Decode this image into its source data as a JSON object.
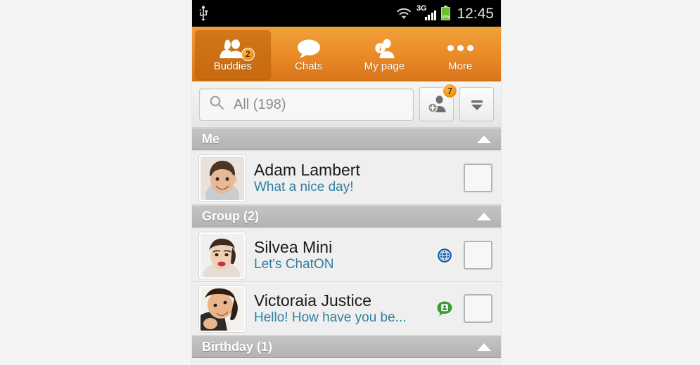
{
  "statusbar": {
    "usb_icon": "usb-icon",
    "wifi_icon": "wifi-icon",
    "network": "3G",
    "signal_icon": "signal-bars-icon",
    "battery_icon": "battery-icon",
    "battery_percent": "97%",
    "clock": "12:45"
  },
  "tabs": [
    {
      "label": "Buddies",
      "icon": "buddies-icon",
      "badge": "2",
      "active": true
    },
    {
      "label": "Chats",
      "icon": "chat-bubble-icon",
      "badge": "",
      "active": false
    },
    {
      "label": "My page",
      "icon": "my-page-info-icon",
      "badge": "",
      "active": false
    },
    {
      "label": "More",
      "icon": "more-dots-icon",
      "badge": "",
      "active": false
    }
  ],
  "search": {
    "icon": "search-icon",
    "value": "All (198)",
    "placeholder": "All (198)"
  },
  "buttons": {
    "add_buddy": {
      "icon": "add-buddy-icon",
      "badge": "7"
    },
    "sort_filter": {
      "icon": "sort-filter-icon"
    }
  },
  "sections": [
    {
      "title": "Me",
      "collapse_icon": "caret-up-icon",
      "rows": [
        {
          "name": "Adam Lambert",
          "status": "What a nice day!",
          "avatar": "avatar-adam",
          "status_icon": "",
          "checkbox": "unchecked"
        }
      ]
    },
    {
      "title": "Group (2)",
      "collapse_icon": "caret-up-icon",
      "rows": [
        {
          "name": "Silvea Mini",
          "status": "Let's ChatON",
          "avatar": "avatar-silvea",
          "status_icon": "globe-icon",
          "checkbox": "unchecked"
        },
        {
          "name": "Victoraia Justice",
          "status": "Hello! How have you be...",
          "avatar": "avatar-victoraia",
          "status_icon": "contact-bubble-icon",
          "checkbox": "unchecked"
        }
      ]
    },
    {
      "title": "Birthday  (1)",
      "collapse_icon": "caret-up-icon",
      "rows": []
    }
  ],
  "colors": {
    "accent_orange": "#ec8e2a",
    "tab_active": "#c8690f",
    "status_text": "#2f7fa0",
    "section_gray": "#b3b3b3",
    "globe_blue": "#1c5ea8",
    "bubble_green": "#3a9b3a",
    "battery_green": "#6abf2a",
    "page_bg": "#f4f4f4"
  }
}
